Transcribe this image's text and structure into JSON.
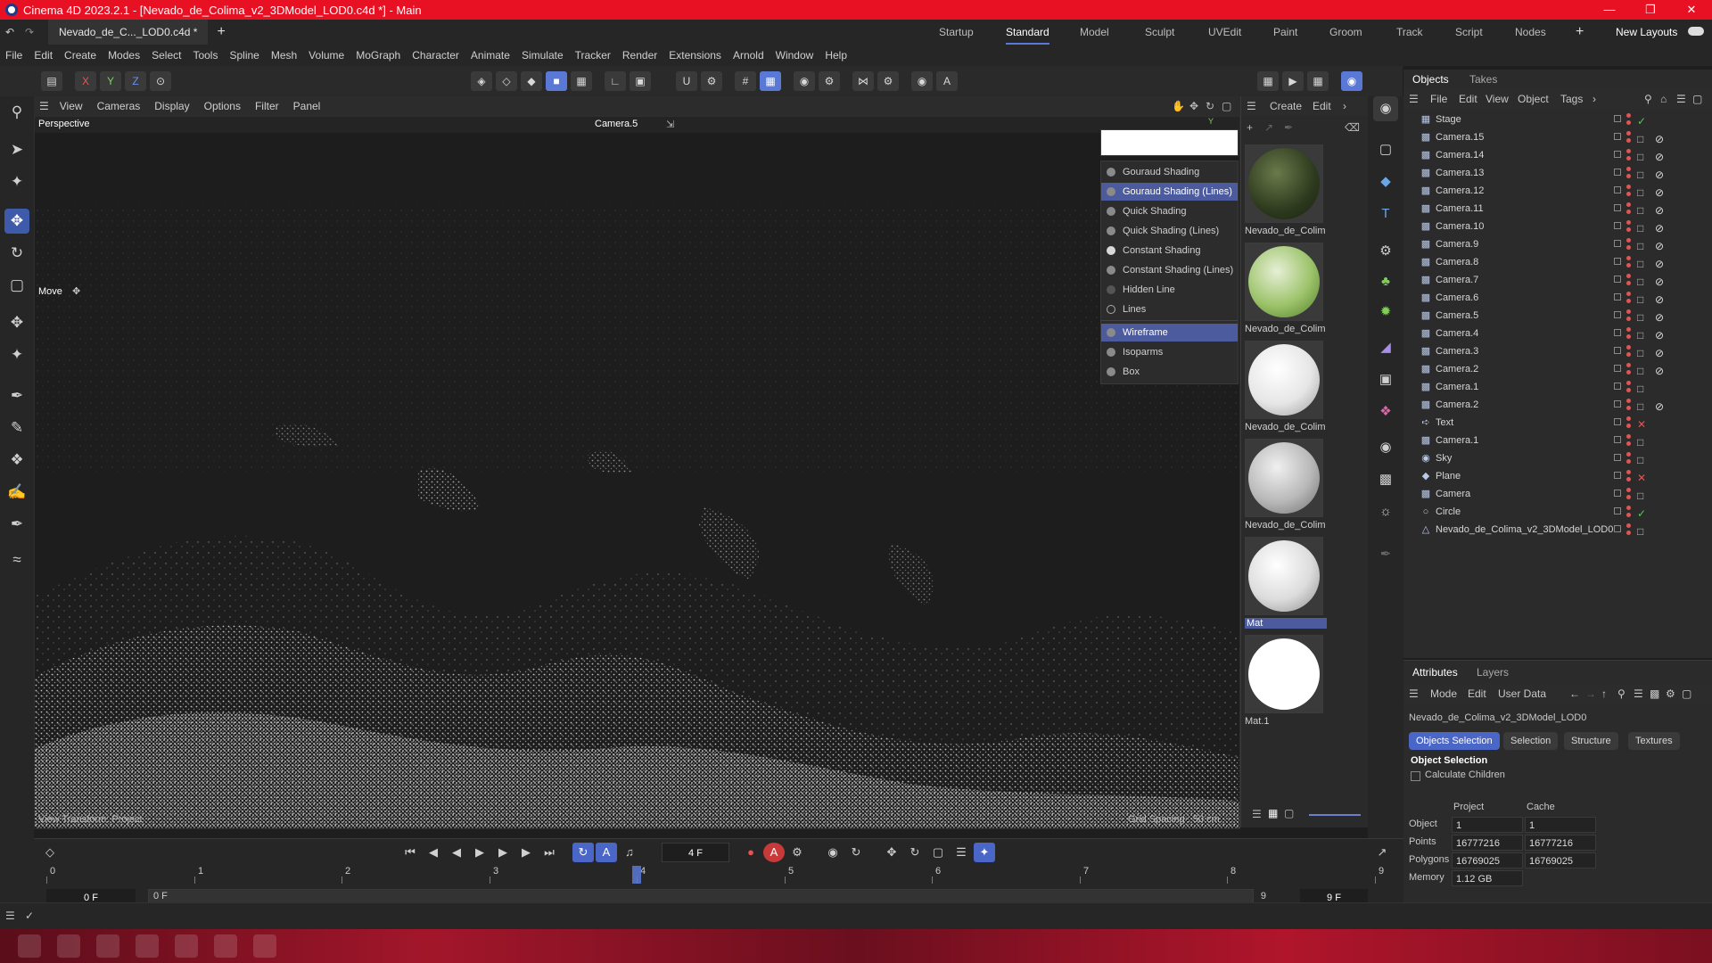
{
  "titlebar": {
    "title": "Cinema 4D 2023.2.1 - [Nevado_de_Colima_v2_3DModel_LOD0.c4d *] - Main"
  },
  "doc_tab": {
    "label": "Nevado_de_C..._LOD0.c4d *"
  },
  "layouts": {
    "items": [
      "Startup",
      "Standard",
      "Model",
      "Sculpt",
      "UVEdit",
      "Paint",
      "Groom",
      "Track",
      "Script",
      "Nodes"
    ],
    "active": "Standard",
    "new_layouts": "New Layouts"
  },
  "menubar": {
    "items": [
      "File",
      "Edit",
      "Create",
      "Modes",
      "Select",
      "Tools",
      "Spline",
      "Mesh",
      "Volume",
      "MoGraph",
      "Character",
      "Animate",
      "Simulate",
      "Tracker",
      "Render",
      "Extensions",
      "Arnold",
      "Window",
      "Help"
    ]
  },
  "axes": {
    "x": "X",
    "y": "Y",
    "z": "Z"
  },
  "viewport": {
    "menu": [
      "View",
      "Cameras",
      "Display",
      "Options",
      "Filter",
      "Panel"
    ],
    "projection": "Perspective",
    "camera": "Camera.5",
    "tool_hint": "Move",
    "transform_label": "View Transform: Project",
    "grid_label": "Grid Spacing : 50 cm",
    "axis_y": "Y"
  },
  "shading_menu": {
    "items": [
      "Gouraud Shading",
      "Gouraud Shading (Lines)",
      "Quick Shading",
      "Quick Shading (Lines)",
      "Constant Shading",
      "Constant Shading (Lines)",
      "Hidden Line",
      "Lines",
      "Wireframe",
      "Isoparms",
      "Box"
    ],
    "selected": [
      "Gouraud Shading (Lines)",
      "Wireframe"
    ]
  },
  "material_panel": {
    "menu": [
      "Create",
      "Edit"
    ],
    "materials": [
      "Nevado_de_Colim",
      "Nevado_de_Colim",
      "Nevado_de_Colim",
      "Nevado_de_Colim",
      "Mat",
      "Mat.1"
    ]
  },
  "objects_panel": {
    "tabs": [
      "Objects",
      "Takes"
    ],
    "menu": [
      "File",
      "Edit",
      "View",
      "Object",
      "Tags"
    ],
    "items": [
      "Stage",
      "Camera.15",
      "Camera.14",
      "Camera.13",
      "Camera.12",
      "Camera.11",
      "Camera.10",
      "Camera.9",
      "Camera.8",
      "Camera.7",
      "Camera.6",
      "Camera.5",
      "Camera.4",
      "Camera.3",
      "Camera.2",
      "Camera.1",
      "Camera.2",
      "Text",
      "Camera.1",
      "Sky",
      "Plane",
      "Camera",
      "Circle",
      "Nevado_de_Colima_v2_3DModel_LOD0"
    ]
  },
  "attributes_panel": {
    "tabs": [
      "Attributes",
      "Layers"
    ],
    "menu": [
      "Mode",
      "Edit",
      "User Data"
    ],
    "object_name": "Nevado_de_Colima_v2_3DModel_LOD0",
    "subtabs": [
      "Objects Selection",
      "Selection",
      "Structure",
      "Textures"
    ],
    "section": "Object Selection",
    "calc_children": "Calculate Children",
    "col_project": "Project",
    "col_cache": "Cache",
    "rows": [
      {
        "label": "Object",
        "project": "1",
        "cache": "1"
      },
      {
        "label": "Points",
        "project": "16777216",
        "cache": "16777216"
      },
      {
        "label": "Polygons",
        "project": "16769025",
        "cache": "16769025"
      },
      {
        "label": "Memory",
        "project": "1.12 GB",
        "cache": ""
      }
    ]
  },
  "timeline": {
    "current_frame": "4 F",
    "ticks": [
      "0",
      "1",
      "2",
      "3",
      "4",
      "5",
      "6",
      "7",
      "8",
      "9"
    ],
    "start": "0 F",
    "range_start": "0 F",
    "range_end": "9 F",
    "end": "9 F",
    "playhead_frame": 4,
    "frame_count": 9
  },
  "colors": {
    "titlebar": "#e81123",
    "accent": "#5a79d6",
    "selection": "#4c5b9e"
  }
}
